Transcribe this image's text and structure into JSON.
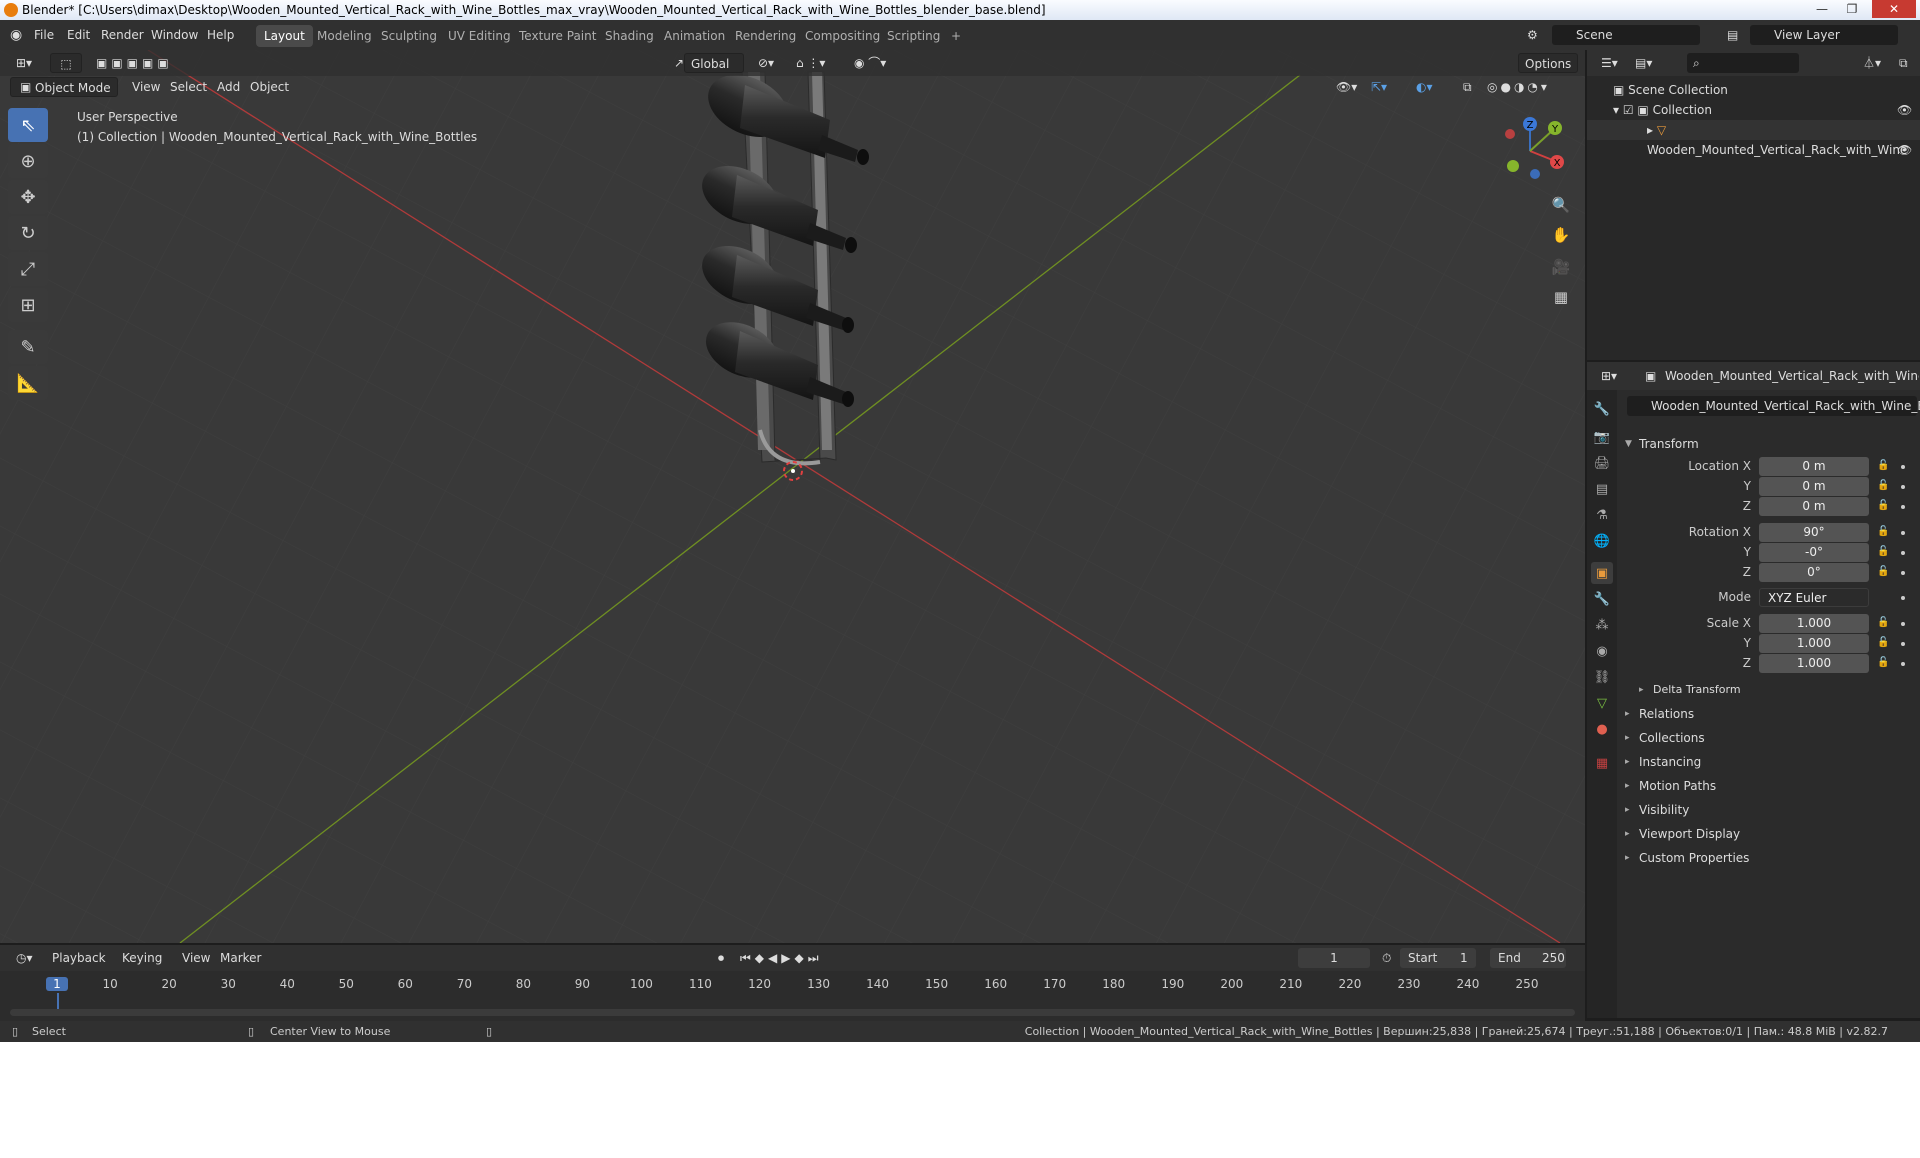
{
  "title_bar": {
    "text": "Blender* [C:\\Users\\dimax\\Desktop\\Wooden_Mounted_Vertical_Rack_with_Wine_Bottles_max_vray\\Wooden_Mounted_Vertical_Rack_with_Wine_Bottles_blender_base.blend]",
    "min": "—",
    "max": "❐",
    "close": "✕"
  },
  "menu": {
    "file": "File",
    "edit": "Edit",
    "render": "Render",
    "window": "Window",
    "help": "Help"
  },
  "workspaces": [
    "Layout",
    "Modeling",
    "Sculpting",
    "UV Editing",
    "Texture Paint",
    "Shading",
    "Animation",
    "Rendering",
    "Compositing",
    "Scripting",
    "+"
  ],
  "scene": "Scene",
  "view_layer": "View Layer",
  "viewport": {
    "mode": "Object Mode",
    "view": "View",
    "select": "Select",
    "add": "Add",
    "object": "Object",
    "orientation": "Global",
    "options": "Options",
    "perspective": "User Perspective",
    "collection_info": "(1) Collection | Wooden_Mounted_Vertical_Rack_with_Wine_Bottles"
  },
  "gizmo": {
    "x": "X",
    "y": "Y",
    "z": "Z"
  },
  "outliner": {
    "scene_collection": "Scene Collection",
    "collection": "Collection",
    "object": "Wooden_Mounted_Vertical_Rack_with_Wine"
  },
  "properties": {
    "object_header": "Wooden_Mounted_Vertical_Rack_with_Wine_Bottles",
    "object_name": "Wooden_Mounted_Vertical_Rack_with_Wine_Bo...",
    "transform": "Transform",
    "location_label": "Location X",
    "rotation_label": "Rotation X",
    "mode_label": "Mode",
    "scale_label": "Scale X",
    "y": "Y",
    "z": "Z",
    "loc": [
      "0 m",
      "0 m",
      "0 m"
    ],
    "rot": [
      "90°",
      "-0°",
      "0°"
    ],
    "mode": "XYZ Euler",
    "scale": [
      "1.000",
      "1.000",
      "1.000"
    ],
    "delta": "Delta Transform",
    "panels": [
      "Relations",
      "Collections",
      "Instancing",
      "Motion Paths",
      "Visibility",
      "Viewport Display",
      "Custom Properties"
    ]
  },
  "timeline": {
    "playback": "Playback",
    "keying": "Keying",
    "view": "View",
    "marker": "Marker",
    "current": "1",
    "start_label": "Start",
    "start": "1",
    "end_label": "End",
    "end": "250",
    "ticks": [
      "1",
      "10",
      "20",
      "30",
      "40",
      "50",
      "60",
      "70",
      "80",
      "90",
      "100",
      "110",
      "120",
      "130",
      "140",
      "150",
      "160",
      "170",
      "180",
      "190",
      "200",
      "210",
      "220",
      "230",
      "240",
      "250"
    ]
  },
  "status": {
    "select": "Select",
    "center": "Center View to Mouse",
    "info": "Collection | Wooden_Mounted_Vertical_Rack_with_Wine_Bottles | Вершин:25,838 | Граней:25,674 | Треуг.:51,188 | Объектов:0/1 | Пам.: 48.8 MiB | v2.82.7"
  }
}
